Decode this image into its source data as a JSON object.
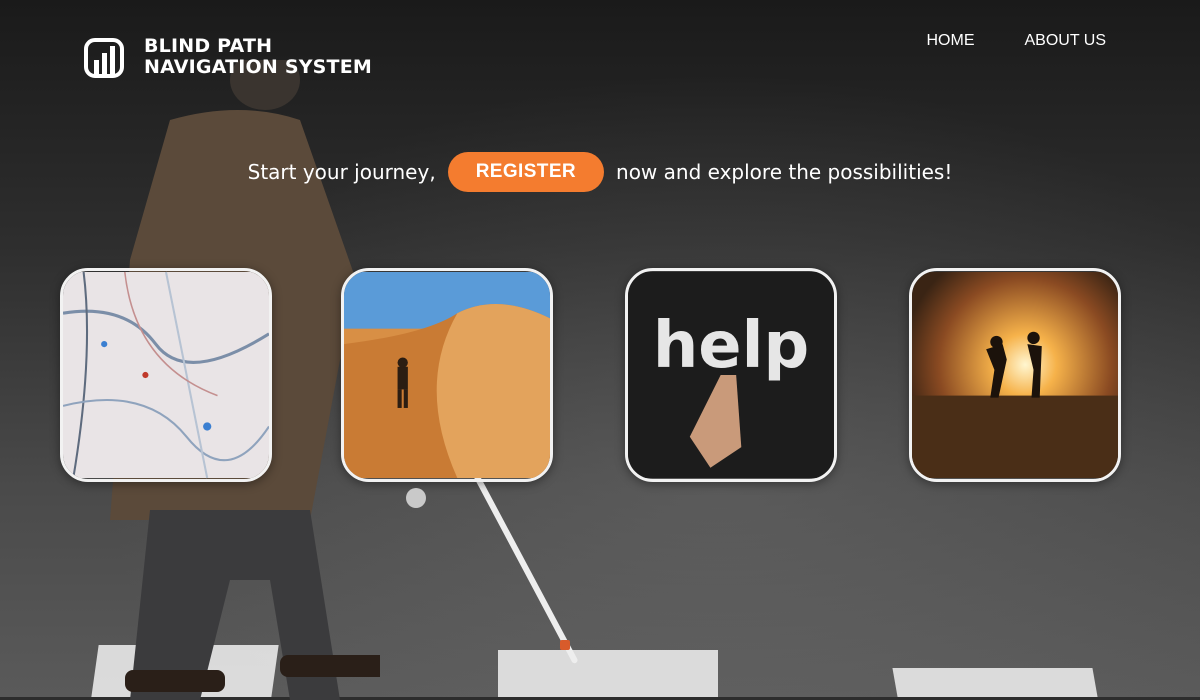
{
  "brand": {
    "line1": "BLIND PATH",
    "line2": "NAVIGATION SYSTEM"
  },
  "nav": {
    "home": "HOME",
    "about": "ABOUT US"
  },
  "hero": {
    "before": "Start your journey,",
    "register": "REGISTER",
    "after": "now and explore the possibilities!"
  },
  "cards": {
    "help_text": "help"
  },
  "colors": {
    "accent": "#f47c2f",
    "text": "#ffffff"
  },
  "icons": {
    "logo": "bar-chart-logo-icon"
  }
}
